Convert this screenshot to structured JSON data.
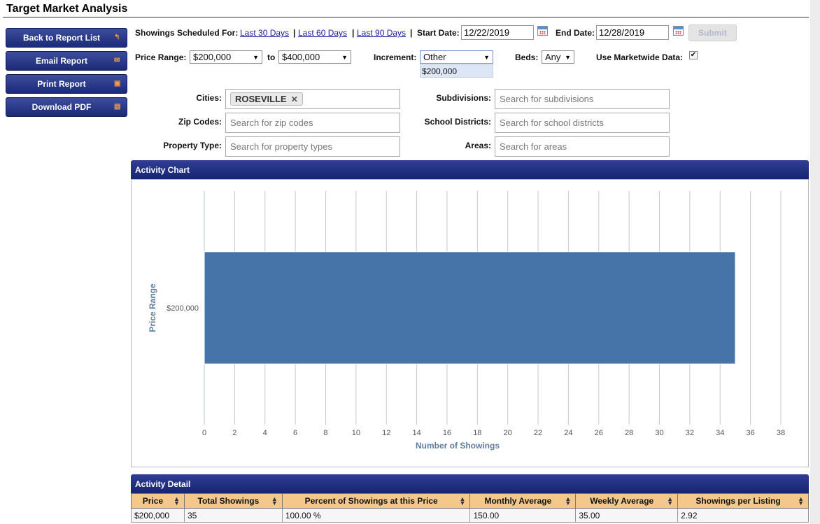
{
  "page": {
    "title": "Target Market Analysis"
  },
  "sidebar": {
    "buttons": [
      {
        "label": "Back to Report List",
        "icon": "return-arrow-icon"
      },
      {
        "label": "Email Report",
        "icon": "envelope-icon"
      },
      {
        "label": "Print Report",
        "icon": "printer-icon"
      },
      {
        "label": "Download PDF",
        "icon": "pdf-icon"
      }
    ]
  },
  "filters": {
    "showings_label": "Showings Scheduled For:",
    "links": [
      "Last 30 Days",
      "Last 60 Days",
      "Last 90 Days"
    ],
    "start_label": "Start Date:",
    "start_value": "12/22/2019",
    "end_label": "End Date:",
    "end_value": "12/28/2019",
    "submit_label": "Submit",
    "price_label": "Price Range:",
    "price_from": "$200,000",
    "to_label": "to",
    "price_to": "$400,000",
    "increment_label": "Increment:",
    "increment_value": "Other",
    "increment_option": "$200,000",
    "beds_label": "Beds:",
    "beds_value": "Any",
    "marketwide_label": "Use Marketwide Data:",
    "marketwide_checked": "✔",
    "cities_label": "Cities:",
    "city_chip": "ROSEVILLE",
    "zip_label": "Zip Codes:",
    "zip_placeholder": "Search for zip codes",
    "ptype_label": "Property Type:",
    "ptype_placeholder": "Search for property types",
    "subdiv_label": "Subdivisions:",
    "subdiv_placeholder": "Search for subdivisions",
    "school_label": "School Districts:",
    "school_placeholder": "Search for school districts",
    "areas_label": "Areas:",
    "areas_placeholder": "Search for areas"
  },
  "activity_chart": {
    "heading": "Activity Chart"
  },
  "chart_data": {
    "type": "bar",
    "orientation": "horizontal",
    "categories": [
      "$200,000"
    ],
    "values": [
      35
    ],
    "xlabel": "Number of Showings",
    "ylabel": "Price Range",
    "xlim": [
      0,
      38
    ],
    "xticks": [
      0,
      2,
      4,
      6,
      8,
      10,
      12,
      14,
      16,
      18,
      20,
      22,
      24,
      26,
      28,
      30,
      32,
      34,
      36,
      38
    ],
    "grid": true,
    "bar_color": "#4674a8"
  },
  "activity_detail": {
    "heading": "Activity Detail",
    "columns": [
      "Price",
      "Total Showings",
      "Percent of Showings at this Price",
      "Monthly Average",
      "Weekly Average",
      "Showings per Listing"
    ],
    "rows": [
      [
        "$200,000",
        "35",
        "100.00 %",
        "150.00",
        "35.00",
        "2.92"
      ]
    ]
  }
}
